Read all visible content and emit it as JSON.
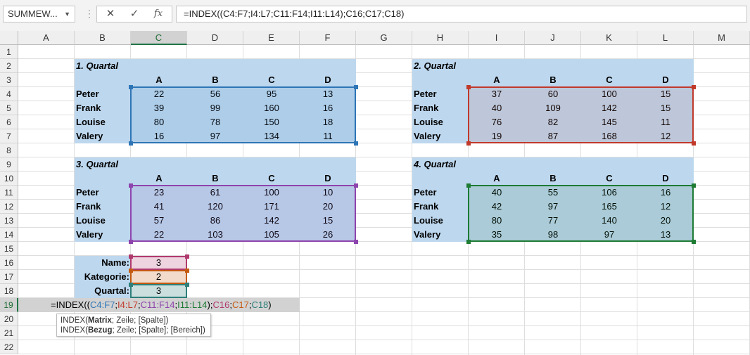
{
  "formula_bar": {
    "name_box": "SUMMEW...",
    "fx": "fx",
    "formula": "=INDEX((C4:F7;I4:L7;C11:F14;I11:L14);C16;C17;C18)"
  },
  "column_headers": [
    "A",
    "B",
    "C",
    "D",
    "E",
    "F",
    "G",
    "H",
    "I",
    "J",
    "K",
    "L",
    "M"
  ],
  "row_headers": [
    "1",
    "2",
    "3",
    "4",
    "5",
    "6",
    "7",
    "8",
    "9",
    "10",
    "11",
    "12",
    "13",
    "14",
    "15",
    "16",
    "17",
    "18",
    "19",
    "20",
    "21",
    "22"
  ],
  "quarters": [
    {
      "title": "1. Quartal",
      "cols": [
        "A",
        "B",
        "C",
        "D"
      ],
      "rows": [
        {
          "name": "Peter",
          "values": [
            "22",
            "56",
            "95",
            "13"
          ]
        },
        {
          "name": "Frank",
          "values": [
            "39",
            "99",
            "160",
            "16"
          ]
        },
        {
          "name": "Louise",
          "values": [
            "80",
            "78",
            "150",
            "18"
          ]
        },
        {
          "name": "Valery",
          "values": [
            "16",
            "97",
            "134",
            "11"
          ]
        }
      ]
    },
    {
      "title": "2. Quartal",
      "cols": [
        "A",
        "B",
        "C",
        "D"
      ],
      "rows": [
        {
          "name": "Peter",
          "values": [
            "37",
            "60",
            "100",
            "15"
          ]
        },
        {
          "name": "Frank",
          "values": [
            "40",
            "109",
            "142",
            "15"
          ]
        },
        {
          "name": "Louise",
          "values": [
            "76",
            "82",
            "145",
            "11"
          ]
        },
        {
          "name": "Valery",
          "values": [
            "19",
            "87",
            "168",
            "12"
          ]
        }
      ]
    },
    {
      "title": "3. Quartal",
      "cols": [
        "A",
        "B",
        "C",
        "D"
      ],
      "rows": [
        {
          "name": "Peter",
          "values": [
            "23",
            "61",
            "100",
            "10"
          ]
        },
        {
          "name": "Frank",
          "values": [
            "41",
            "120",
            "171",
            "20"
          ]
        },
        {
          "name": "Louise",
          "values": [
            "57",
            "86",
            "142",
            "15"
          ]
        },
        {
          "name": "Valery",
          "values": [
            "22",
            "103",
            "105",
            "26"
          ]
        }
      ]
    },
    {
      "title": "4. Quartal",
      "cols": [
        "A",
        "B",
        "C",
        "D"
      ],
      "rows": [
        {
          "name": "Peter",
          "values": [
            "40",
            "55",
            "106",
            "16"
          ]
        },
        {
          "name": "Frank",
          "values": [
            "42",
            "97",
            "165",
            "12"
          ]
        },
        {
          "name": "Louise",
          "values": [
            "80",
            "77",
            "140",
            "20"
          ]
        },
        {
          "name": "Valery",
          "values": [
            "35",
            "98",
            "97",
            "13"
          ]
        }
      ]
    }
  ],
  "inputs": [
    {
      "label": "Name:",
      "value": "3"
    },
    {
      "label": "Kategorie:",
      "value": "2"
    },
    {
      "label": "Quartal:",
      "value": "3"
    }
  ],
  "cell_formula": {
    "prefix": "=INDEX((",
    "ref1": "C4:F7",
    "ref2": "I4:L7",
    "ref3": "C11:F14",
    "ref4": "I11:L14",
    "mid": ");",
    "ref5": "C16",
    "ref6": "C17",
    "ref7": "C18",
    "semicolon": ";",
    "suffix": ")"
  },
  "tooltip": {
    "line1_fn": "INDEX(",
    "line1_bold": "Matrix",
    "line1_rest": "; Zeile; [Spalte])",
    "line2_fn": "INDEX(",
    "line2_bold": "Bezug",
    "line2_rest": "; Zeile; [Spalte]; [Bereich])"
  },
  "colors": {
    "range1": "#2e75b6",
    "range2": "#c0392b",
    "range3": "#8e44ad",
    "range4": "#1e7b34",
    "ref_c16": "#b03a6e",
    "ref_c17": "#c55a11",
    "ref_c18": "#2f7f7a",
    "block_fill": "#bdd7ee"
  }
}
